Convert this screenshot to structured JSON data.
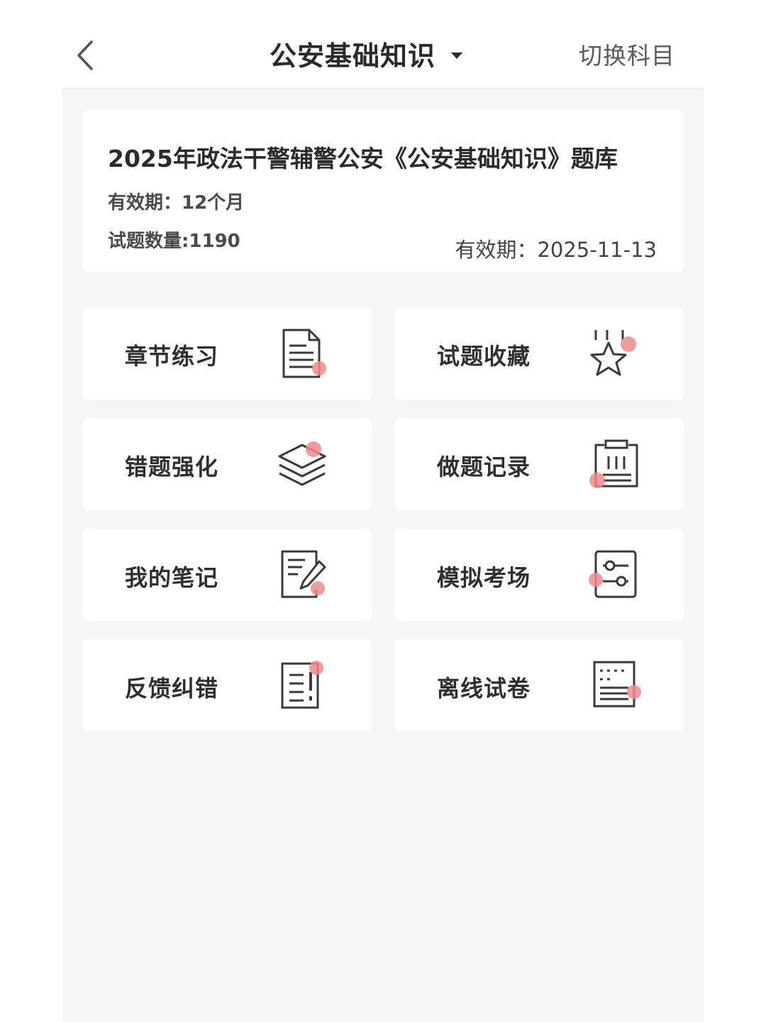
{
  "header": {
    "title": "公安基础知识",
    "switch_label": "切换科目"
  },
  "bank": {
    "title": "2025年政法干警辅警公安《公安基础知识》题库",
    "validity": "有效期：12个月",
    "count": "试题数量:1190",
    "expiry": "有效期：2025-11-13"
  },
  "menu": [
    {
      "label": "章节练习",
      "icon": "document-icon"
    },
    {
      "label": "试题收藏",
      "icon": "star-icon"
    },
    {
      "label": "错题强化",
      "icon": "layers-icon"
    },
    {
      "label": "做题记录",
      "icon": "clipboard-icon"
    },
    {
      "label": "我的笔记",
      "icon": "note-edit-icon"
    },
    {
      "label": "模拟考场",
      "icon": "sliders-icon"
    },
    {
      "label": "反馈纠错",
      "icon": "feedback-icon"
    },
    {
      "label": "离线试卷",
      "icon": "offline-paper-icon"
    }
  ],
  "colors": {
    "accent_dot": "#f0898a",
    "icon_stroke": "#3a3a3a",
    "background": "#f6f6f6"
  }
}
